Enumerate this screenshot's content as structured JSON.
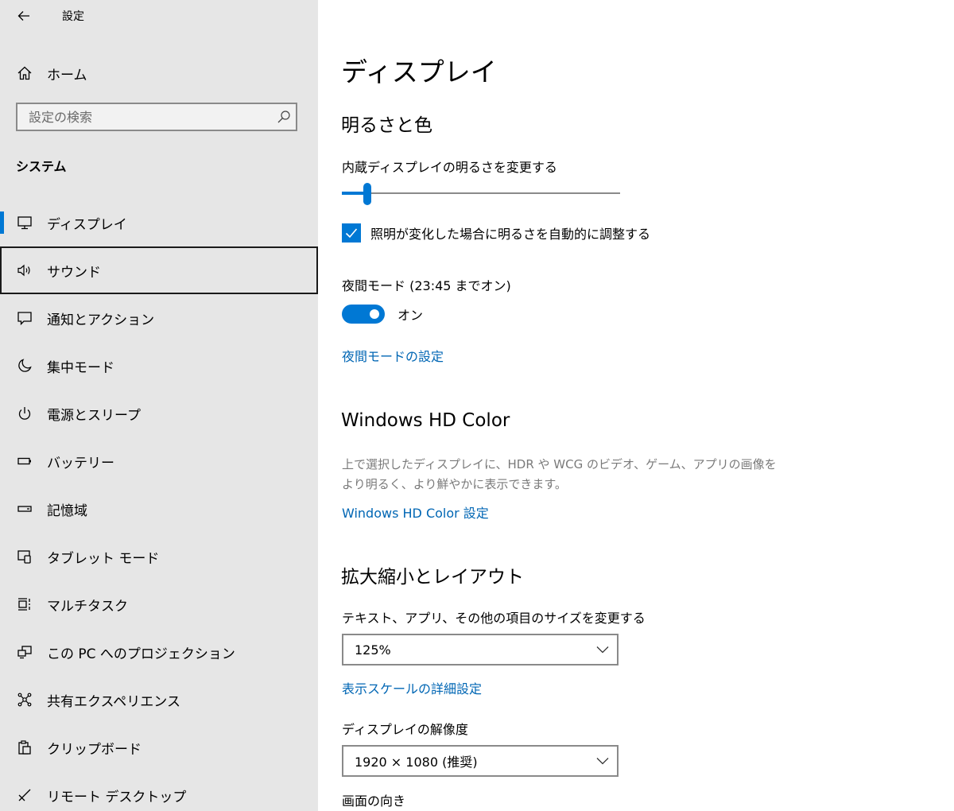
{
  "window": {
    "title": "設定"
  },
  "sidebar": {
    "home_label": "ホーム",
    "search_placeholder": "設定の検索",
    "section_title": "システム",
    "items": [
      {
        "label": "ディスプレイ",
        "icon": "monitor-icon"
      },
      {
        "label": "サウンド",
        "icon": "speaker-icon"
      },
      {
        "label": "通知とアクション",
        "icon": "notification-icon"
      },
      {
        "label": "集中モード",
        "icon": "moon-icon"
      },
      {
        "label": "電源とスリープ",
        "icon": "power-icon"
      },
      {
        "label": "バッテリー",
        "icon": "battery-icon"
      },
      {
        "label": "記憶域",
        "icon": "storage-icon"
      },
      {
        "label": "タブレット モード",
        "icon": "tablet-icon"
      },
      {
        "label": "マルチタスク",
        "icon": "multitask-icon"
      },
      {
        "label": "この PC へのプロジェクション",
        "icon": "projection-icon"
      },
      {
        "label": "共有エクスペリエンス",
        "icon": "shared-experience-icon"
      },
      {
        "label": "クリップボード",
        "icon": "clipboard-icon"
      },
      {
        "label": "リモート デスクトップ",
        "icon": "remote-desktop-icon"
      }
    ]
  },
  "main": {
    "page_title": "ディスプレイ",
    "brightness_section": {
      "title": "明るさと色",
      "brightness_label": "内蔵ディスプレイの明るさを変更する",
      "brightness_value": 0.09,
      "auto_brightness_label": "照明が変化した場合に明るさを自動的に調整する",
      "auto_brightness_checked": true,
      "night_light_label": "夜間モード (23:45 までオン)",
      "night_light_state": "オン",
      "night_light_on": true,
      "night_light_settings_link": "夜間モードの設定"
    },
    "hd_color_section": {
      "title": "Windows HD Color",
      "description_line1": "上で選択したディスプレイに、HDR や WCG のビデオ、ゲーム、アプリの画像を",
      "description_line2": "より明るく、より鮮やかに表示できます。",
      "settings_link": "Windows HD Color 設定"
    },
    "scale_section": {
      "title": "拡大縮小とレイアウト",
      "scale_label": "テキスト、アプリ、その他の項目のサイズを変更する",
      "scale_value": "125%",
      "advanced_scale_link": "表示スケールの詳細設定",
      "resolution_label": "ディスプレイの解像度",
      "resolution_value": "1920 × 1080 (推奨)",
      "orientation_label": "画面の向き"
    }
  },
  "colors": {
    "accent": "#0078d4",
    "link": "#0066b4",
    "sidebar_bg": "#e6e6e6"
  }
}
